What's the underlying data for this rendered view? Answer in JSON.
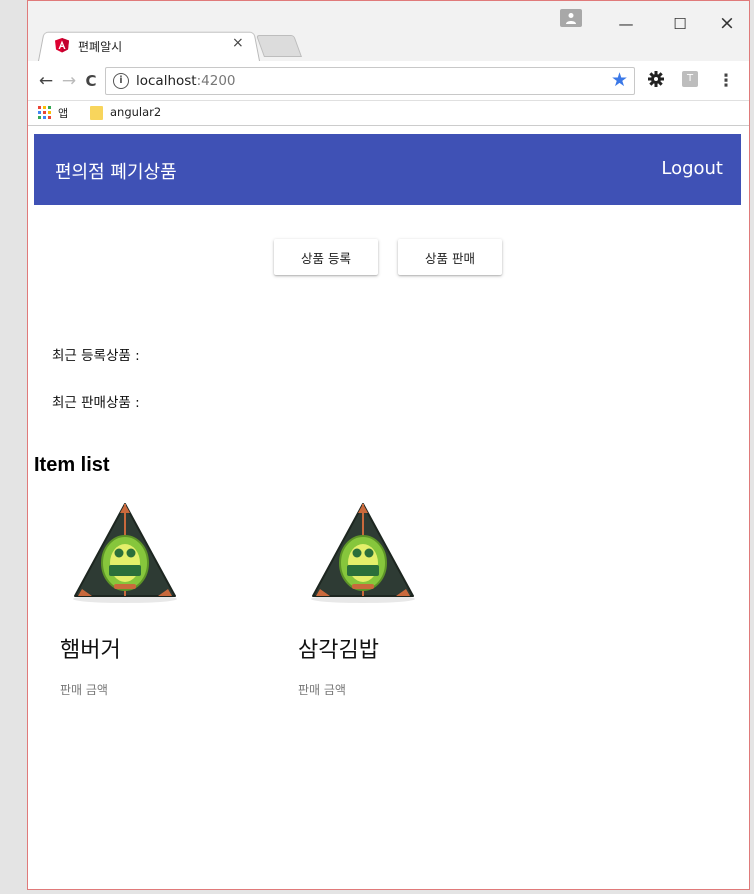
{
  "browser": {
    "tab_title": "편폐알시",
    "tab_close": "×",
    "window_controls": {
      "minimize": "—",
      "maximize": "☐",
      "close": "×"
    },
    "nav": {
      "back": "←",
      "forward": "→",
      "reload": "C"
    },
    "url": {
      "host": "localhost",
      "port": ":4200"
    },
    "bookmarks": {
      "apps_label": "앱",
      "folder_label": "angular2"
    },
    "ext_letter": "T",
    "menu": "⋮",
    "colors": {
      "angular_red": "#dd0031",
      "star_blue": "#3b78e7"
    }
  },
  "header": {
    "title": "편의점 폐기상품",
    "logout_label": "Logout",
    "color": "#3f51b5"
  },
  "actions": {
    "register_label": "상품 등록",
    "sell_label": "상품 판매"
  },
  "recent": {
    "registered_label": "최근 등록상품 :",
    "sold_label": "최근 판매상품 :"
  },
  "item_list": {
    "title": "Item list",
    "items": [
      {
        "name": "햄버거",
        "price_label": "판매 금액"
      },
      {
        "name": "삼각김밥",
        "price_label": "판매 금액"
      }
    ]
  }
}
